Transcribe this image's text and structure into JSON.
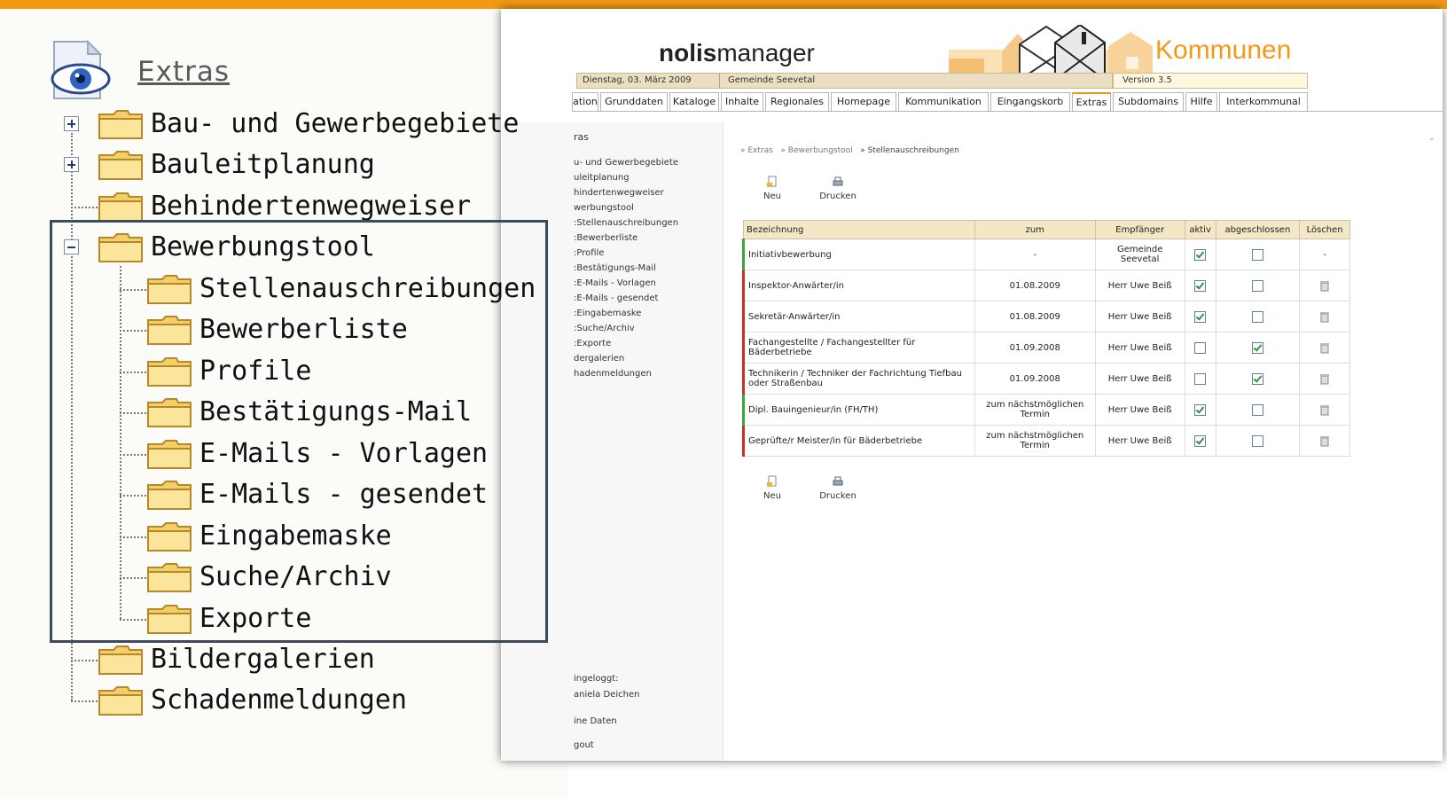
{
  "tree": {
    "root_label": "Extras",
    "items": [
      {
        "label": "Bau- und Gewerbegebiete",
        "toggle": "plus"
      },
      {
        "label": "Bauleitplanung",
        "toggle": "plus"
      },
      {
        "label": "Behindertenwegweiser",
        "toggle": ""
      },
      {
        "label": "Bewerbungstool",
        "toggle": "minus"
      },
      {
        "label": "Stellenauschreibungen",
        "toggle": ""
      },
      {
        "label": "Bewerberliste",
        "toggle": ""
      },
      {
        "label": "Profile",
        "toggle": ""
      },
      {
        "label": "Bestätigungs-Mail",
        "toggle": ""
      },
      {
        "label": "E-Mails - Vorlagen",
        "toggle": ""
      },
      {
        "label": "E-Mails - gesendet",
        "toggle": ""
      },
      {
        "label": "Eingabemaske",
        "toggle": ""
      },
      {
        "label": "Suche/Archiv",
        "toggle": ""
      },
      {
        "label": "Exporte",
        "toggle": ""
      },
      {
        "label": "Bildergalerien",
        "toggle": ""
      },
      {
        "label": "Schadenmeldungen",
        "toggle": ""
      }
    ]
  },
  "app": {
    "brand_bold": "nolis",
    "brand_rest": "manager",
    "tagline": "Kommunen",
    "date": "Dienstag, 03. März 2009",
    "municipality": "Gemeinde Seevetal",
    "version": "Version 3.5",
    "tabs": [
      "ation",
      "Grunddaten",
      "Kataloge",
      "Inhalte",
      "Regionales",
      "Homepage",
      "Kommunikation",
      "Eingangskorb",
      "Extras",
      "Subdomains",
      "Hilfe",
      "Interkommunal"
    ],
    "active_tab": "Extras",
    "nav_title": "ras",
    "nav_items": [
      "u- und Gewerbegebiete",
      "uleitplanung",
      "hindertenwegweiser",
      "werbungstool",
      ":Stellenauschreibungen",
      ":Bewerberliste",
      ":Profile",
      ":Bestätigungs-Mail",
      ":E-Mails - Vorlagen",
      ":E-Mails - gesendet",
      ":Eingabemaske",
      ":Suche/Archiv",
      ":Exporte",
      "dergalerien",
      "hadenmeldungen"
    ],
    "login_line1": "ingeloggt:",
    "login_line2": "aniela Deichen",
    "my_data": "ine Daten",
    "logout": "gout",
    "breadcrumb": [
      "» Extras",
      "» Bewerbungstool",
      "» Stellenauschreibungen"
    ],
    "btn_new": "Neu",
    "btn_print": "Drucken",
    "columns": [
      "Bezeichnung",
      "zum",
      "Empfänger",
      "aktiv",
      "abgeschlossen",
      "Löschen"
    ],
    "rows": [
      {
        "title": "Initiativbewerbung",
        "date": "-",
        "recipient": "Gemeinde Seevetal",
        "active": true,
        "closed": false,
        "deletable": false,
        "status": "green"
      },
      {
        "title": "Inspektor-Anwärter/in",
        "date": "01.08.2009",
        "recipient": "Herr Uwe Beiß",
        "active": true,
        "closed": false,
        "deletable": true,
        "status": "red"
      },
      {
        "title": "Sekretär-Anwärter/in",
        "date": "01.08.2009",
        "recipient": "Herr Uwe Beiß",
        "active": true,
        "closed": false,
        "deletable": true,
        "status": "red"
      },
      {
        "title": "Fachangestellte / Fachangestellter für Bäderbetriebe",
        "date": "01.09.2008",
        "recipient": "Herr Uwe Beiß",
        "active": false,
        "closed": true,
        "deletable": true,
        "status": "red"
      },
      {
        "title": "Technikerin / Techniker der Fachrichtung Tiefbau oder Straßenbau",
        "date": "01.09.2008",
        "recipient": "Herr Uwe Beiß",
        "active": false,
        "closed": true,
        "deletable": true,
        "status": "red"
      },
      {
        "title": "Dipl. Bauingenieur/in (FH/TH)",
        "date": "zum nächstmöglichen Termin",
        "recipient": "Herr Uwe Beiß",
        "active": true,
        "closed": false,
        "deletable": true,
        "status": "green"
      },
      {
        "title": "Geprüfte/r Meister/in für Bäderbetriebe",
        "date": "zum nächstmöglichen Termin",
        "recipient": "Herr Uwe Beiß",
        "active": true,
        "closed": false,
        "deletable": true,
        "status": "red"
      }
    ]
  },
  "colors": {
    "accent": "#f29a16",
    "header_row": "#f4e7c6",
    "status_green": "#35a93a",
    "status_red": "#d02a2a"
  }
}
